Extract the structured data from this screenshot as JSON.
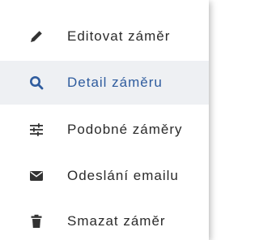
{
  "menu": {
    "items": [
      {
        "label": "Editovat záměr",
        "icon": "pencil-icon",
        "active": false
      },
      {
        "label": "Detail záměru",
        "icon": "search-icon",
        "active": true
      },
      {
        "label": "Podobné záměry",
        "icon": "sliders-icon",
        "active": false
      },
      {
        "label": "Odeslání emailu",
        "icon": "envelope-icon",
        "active": false
      },
      {
        "label": "Smazat záměr",
        "icon": "trash-icon",
        "active": false
      }
    ]
  },
  "colors": {
    "active_text": "#2f5c9e",
    "active_background": "#eef0f3",
    "text": "#2b2b2b",
    "icon": "#333333"
  }
}
